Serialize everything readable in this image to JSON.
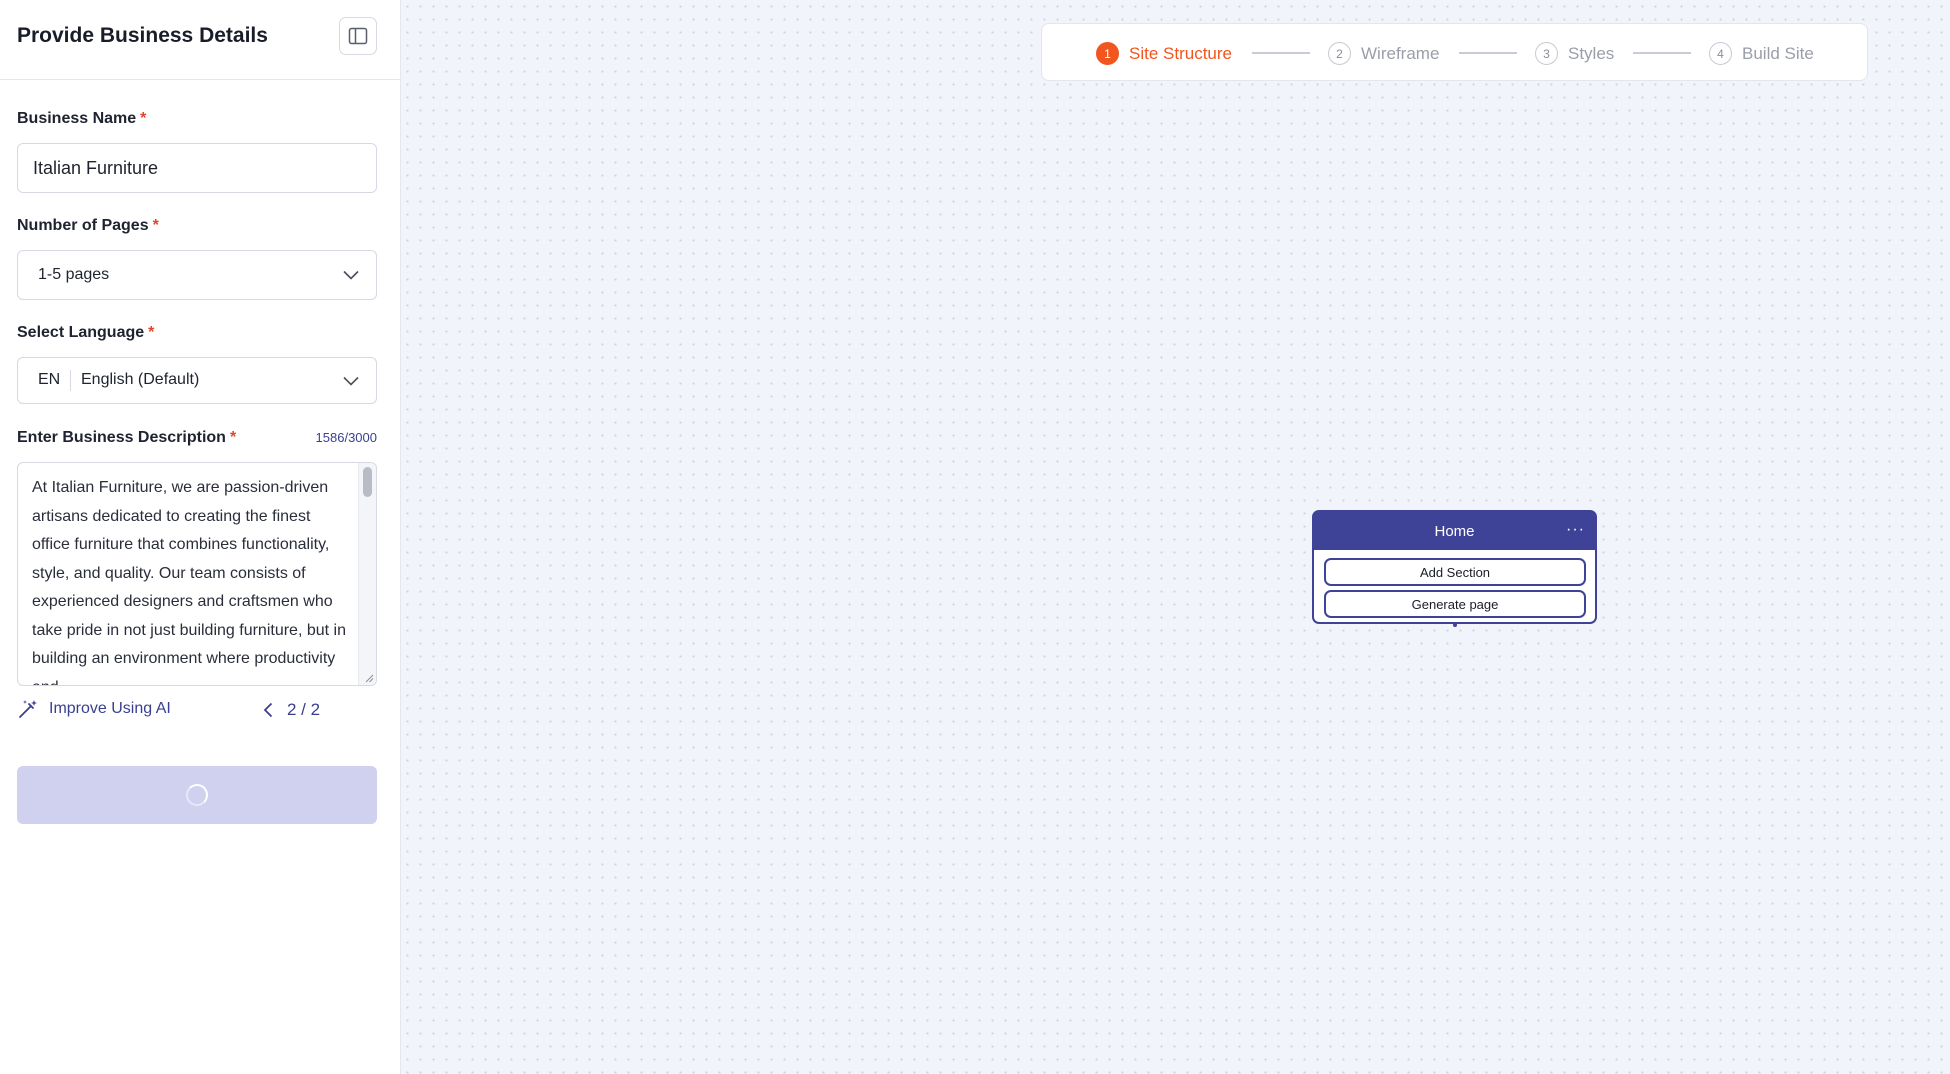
{
  "sidebar": {
    "title": "Provide Business Details",
    "collapse_icon": "sidebar-panel-icon",
    "business_name": {
      "label": "Business Name",
      "required_mark": "*",
      "value": "Italian Furniture"
    },
    "pages": {
      "label": "Number of Pages",
      "required_mark": "*",
      "value": "1-5 pages"
    },
    "language": {
      "label": "Select Language",
      "required_mark": "*",
      "code": "EN",
      "value": "English (Default)"
    },
    "description": {
      "label": "Enter Business Description",
      "required_mark": "*",
      "counter": "1586/3000",
      "value": "At Italian Furniture, we are passion-driven artisans dedicated to creating the finest office furniture that combines functionality, style, and quality. Our team consists of experienced designers and craftsmen who take pride in not just building furniture, but in building an environment where productivity and"
    },
    "improve_label": "Improve Using AI",
    "pager": "2 / 2"
  },
  "stepper": {
    "steps": [
      {
        "num": "1",
        "label": "Site Structure",
        "active": true
      },
      {
        "num": "2",
        "label": "Wireframe",
        "active": false
      },
      {
        "num": "3",
        "label": "Styles",
        "active": false
      },
      {
        "num": "4",
        "label": "Build Site",
        "active": false
      }
    ]
  },
  "node": {
    "title": "Home",
    "menu": "···",
    "add_section": "Add Section",
    "generate_page": "Generate page"
  },
  "colors": {
    "accent": "#3e4397",
    "active_step": "#f2551d",
    "required": "#e0452b"
  }
}
